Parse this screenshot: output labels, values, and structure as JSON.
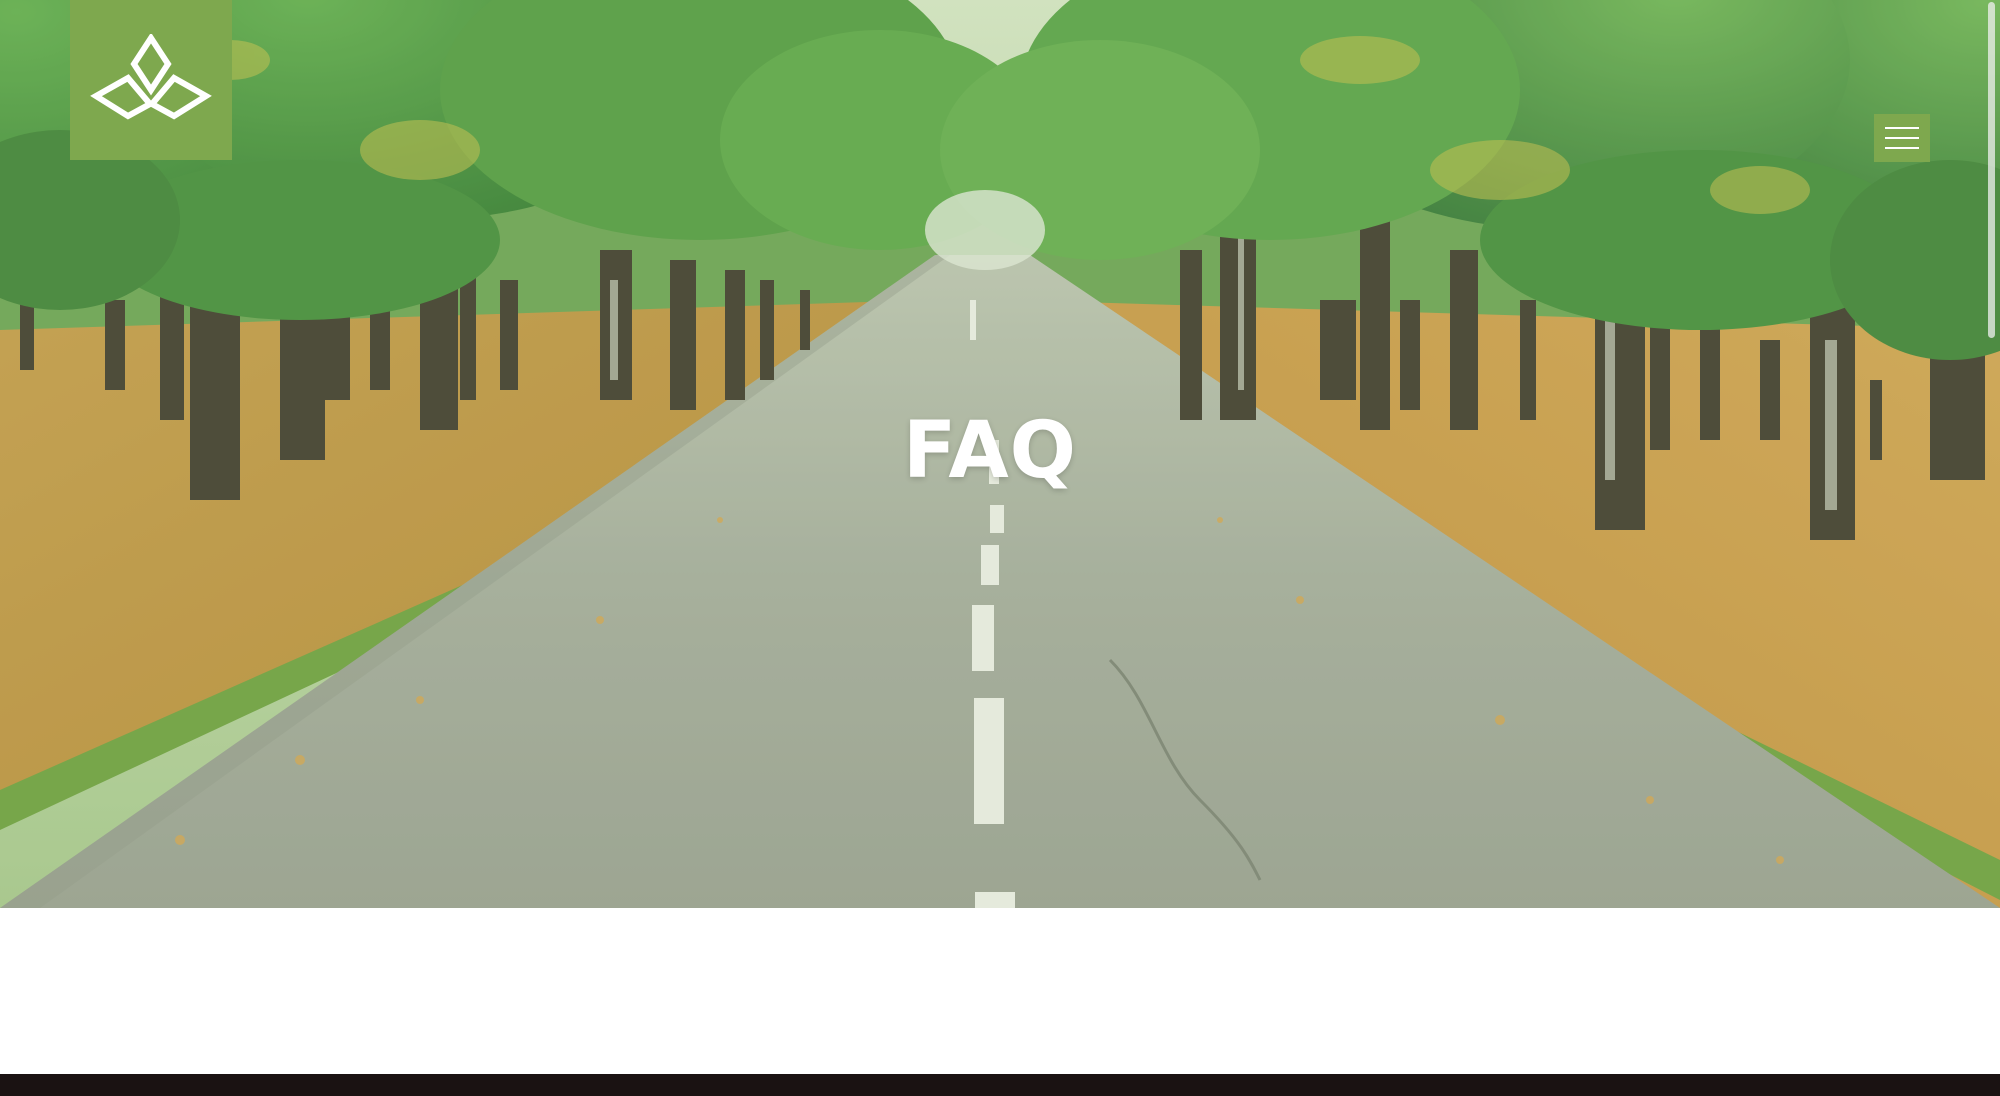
{
  "hero": {
    "title": "FAQ",
    "image_subject": "tree-lined-road-autumn"
  },
  "header": {
    "logo_icon": "lotus-leaf-logo-icon",
    "menu_icon": "hamburger-menu-icon"
  },
  "colors": {
    "brand_green": "#7ea84e",
    "footer_dark": "#1a1212",
    "text_white": "#ffffff"
  }
}
